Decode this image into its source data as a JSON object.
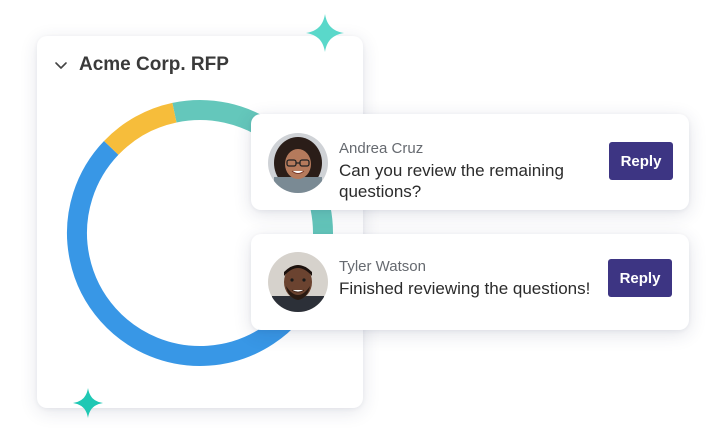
{
  "colors": {
    "accent_teal": "#5ecfc0",
    "sparkle": "#4fd8c8",
    "reply_button": "#3d3583",
    "donut_blue": "#3897e6",
    "donut_yellow": "#f6bd3b",
    "donut_teal": "#64c7bb"
  },
  "rfp_card": {
    "title": "Acme Corp. RFP",
    "toggle_icon": "chevron-down-icon",
    "progress": [
      {
        "name": "blue",
        "fraction": 0.62,
        "color": "#3897e6"
      },
      {
        "name": "yellow",
        "fraction": 0.095,
        "color": "#f6bd3b"
      },
      {
        "name": "teal",
        "fraction": 0.285,
        "color": "#64c7bb"
      }
    ]
  },
  "comments": [
    {
      "author": "Andrea Cruz",
      "text": "Can you review the remaining questions?",
      "reply_label": "Reply",
      "avatar_icon": "user-avatar"
    },
    {
      "author": "Tyler Watson",
      "text": "Finished reviewing the questions!",
      "reply_label": "Reply",
      "avatar_icon": "user-avatar"
    }
  ]
}
